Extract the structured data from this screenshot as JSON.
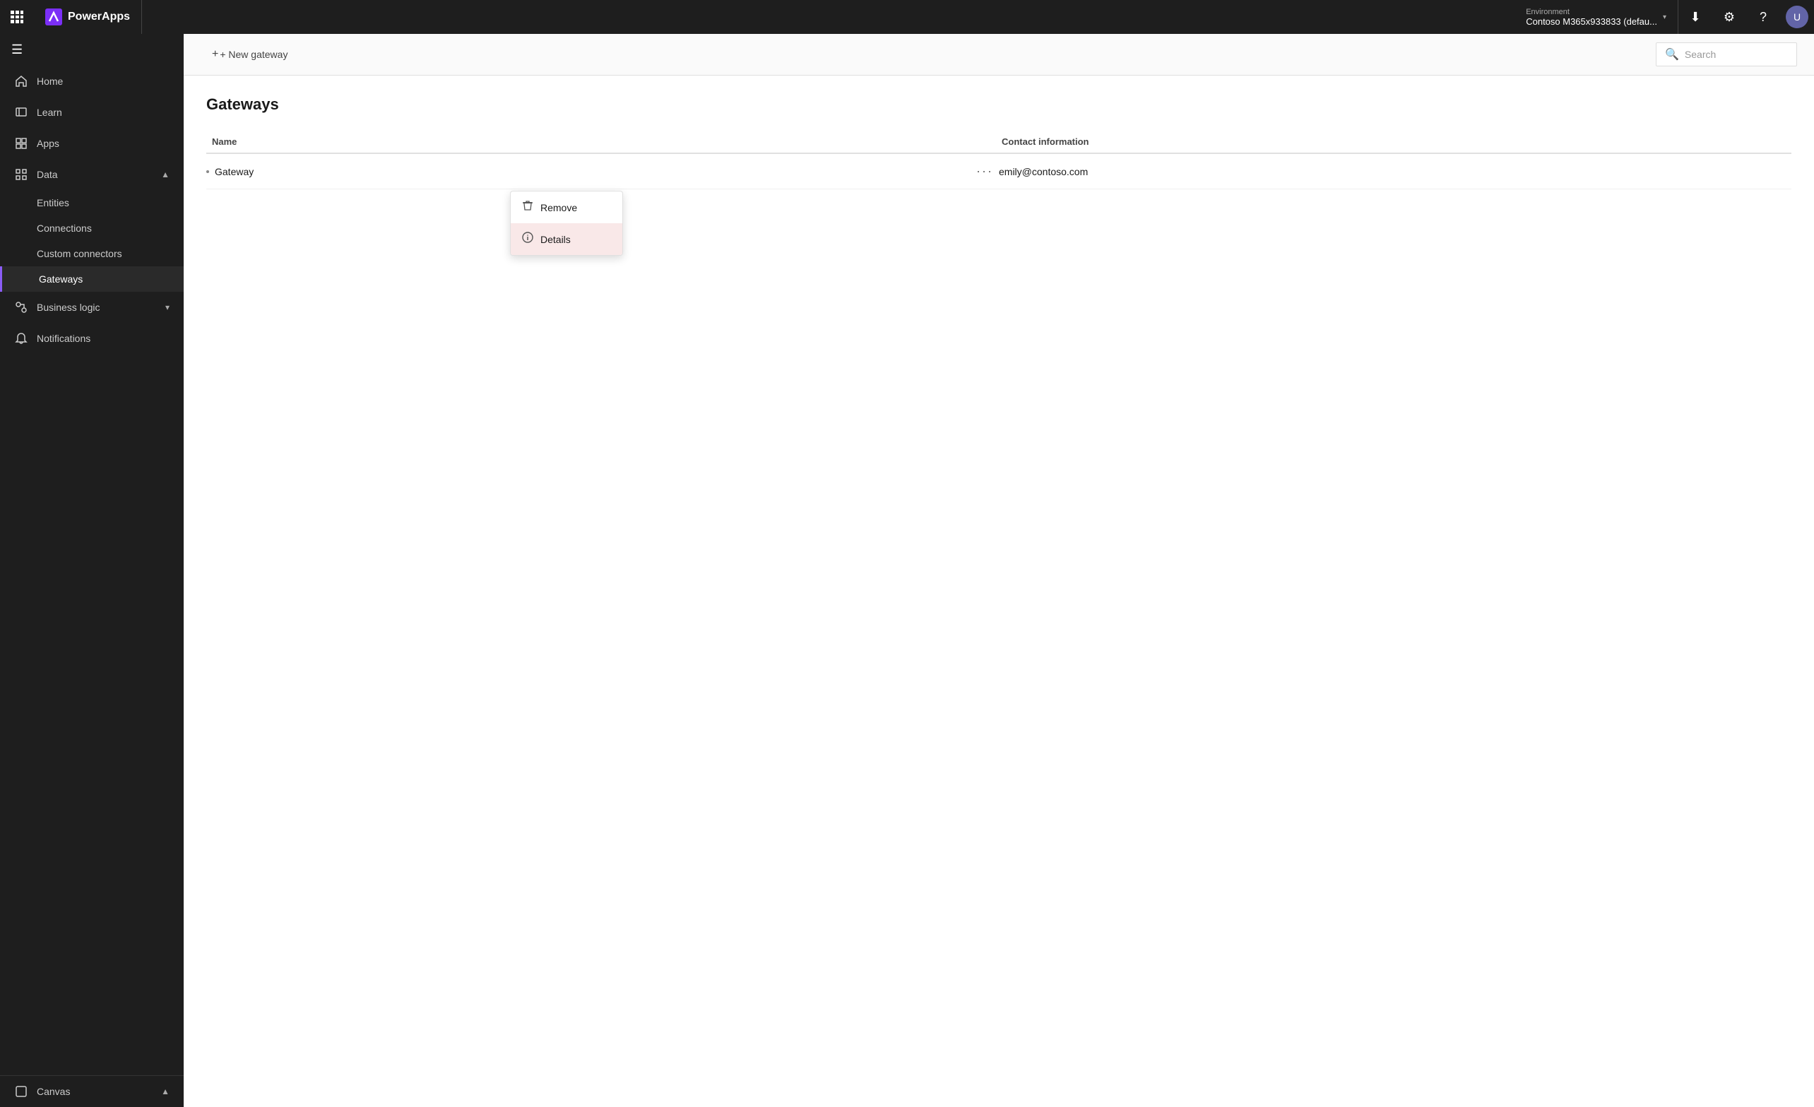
{
  "app": {
    "title": "PowerApps"
  },
  "topbar": {
    "waffle_label": "⊞",
    "env_label": "Environment",
    "env_name": "Contoso M365x933833 (defau...",
    "download_icon": "⬇",
    "settings_icon": "⚙",
    "help_icon": "?",
    "avatar_label": "U"
  },
  "search": {
    "placeholder": "Search",
    "icon": "🔍"
  },
  "sidebar": {
    "toggle_icon": "☰",
    "items": [
      {
        "id": "home",
        "label": "Home",
        "icon": "⌂",
        "active": false
      },
      {
        "id": "learn",
        "label": "Learn",
        "icon": "📖",
        "active": false
      },
      {
        "id": "apps",
        "label": "Apps",
        "icon": "⬜",
        "active": false
      },
      {
        "id": "data",
        "label": "Data",
        "icon": "⊞",
        "active": false,
        "expanded": true
      },
      {
        "id": "business-logic",
        "label": "Business logic",
        "icon": "⚡",
        "active": false,
        "expanded": true
      },
      {
        "id": "notifications",
        "label": "Notifications",
        "icon": "🔔",
        "active": false
      }
    ],
    "sub_items_data": [
      {
        "id": "entities",
        "label": "Entities"
      },
      {
        "id": "connections",
        "label": "Connections"
      },
      {
        "id": "custom-connectors",
        "label": "Custom connectors"
      },
      {
        "id": "gateways",
        "label": "Gateways"
      }
    ],
    "bottom": {
      "label": "Canvas",
      "icon": "◻",
      "chevron": "▲"
    }
  },
  "toolbar": {
    "new_gateway_label": "+ New gateway"
  },
  "page": {
    "title": "Gateways",
    "table": {
      "col_name": "Name",
      "col_contact": "Contact information",
      "rows": [
        {
          "name": "Gateway",
          "contact": "emily@contoso.com"
        }
      ]
    }
  },
  "context_menu": {
    "items": [
      {
        "id": "remove",
        "label": "Remove",
        "icon": "🗑"
      },
      {
        "id": "details",
        "label": "Details",
        "icon": "ℹ"
      }
    ]
  }
}
